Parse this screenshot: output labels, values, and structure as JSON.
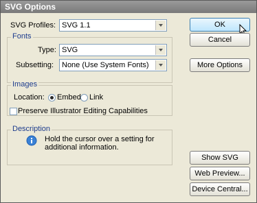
{
  "window": {
    "title": "SVG Options"
  },
  "svg_profiles": {
    "label": "SVG Profiles:",
    "value": "SVG 1.1"
  },
  "fonts": {
    "group_title": "Fonts",
    "type_label": "Type:",
    "type_value": "SVG",
    "subsetting_label": "Subsetting:",
    "subsetting_value": "None (Use System Fonts)"
  },
  "images": {
    "group_title": "Images",
    "location_label": "Location:",
    "embed_label": "Embed",
    "link_label": "Link",
    "selected": "Embed"
  },
  "preserve": {
    "label": "Preserve Illustrator Editing Capabilities",
    "checked": false
  },
  "description": {
    "group_title": "Description",
    "text": "Hold the cursor over a setting for additional information."
  },
  "buttons": {
    "ok": "OK",
    "cancel": "Cancel",
    "more_options": "More Options",
    "show_svg_code": "Show SVG Code...",
    "web_preview": "Web Preview...",
    "device_central": "Device Central..."
  },
  "colors": {
    "accent": "#1c3b8c",
    "ok_border": "#3c7fb1",
    "dialog_bg": "#ece9d8"
  },
  "icons": {
    "info": "info-icon",
    "cursor": "cursor-icon"
  }
}
